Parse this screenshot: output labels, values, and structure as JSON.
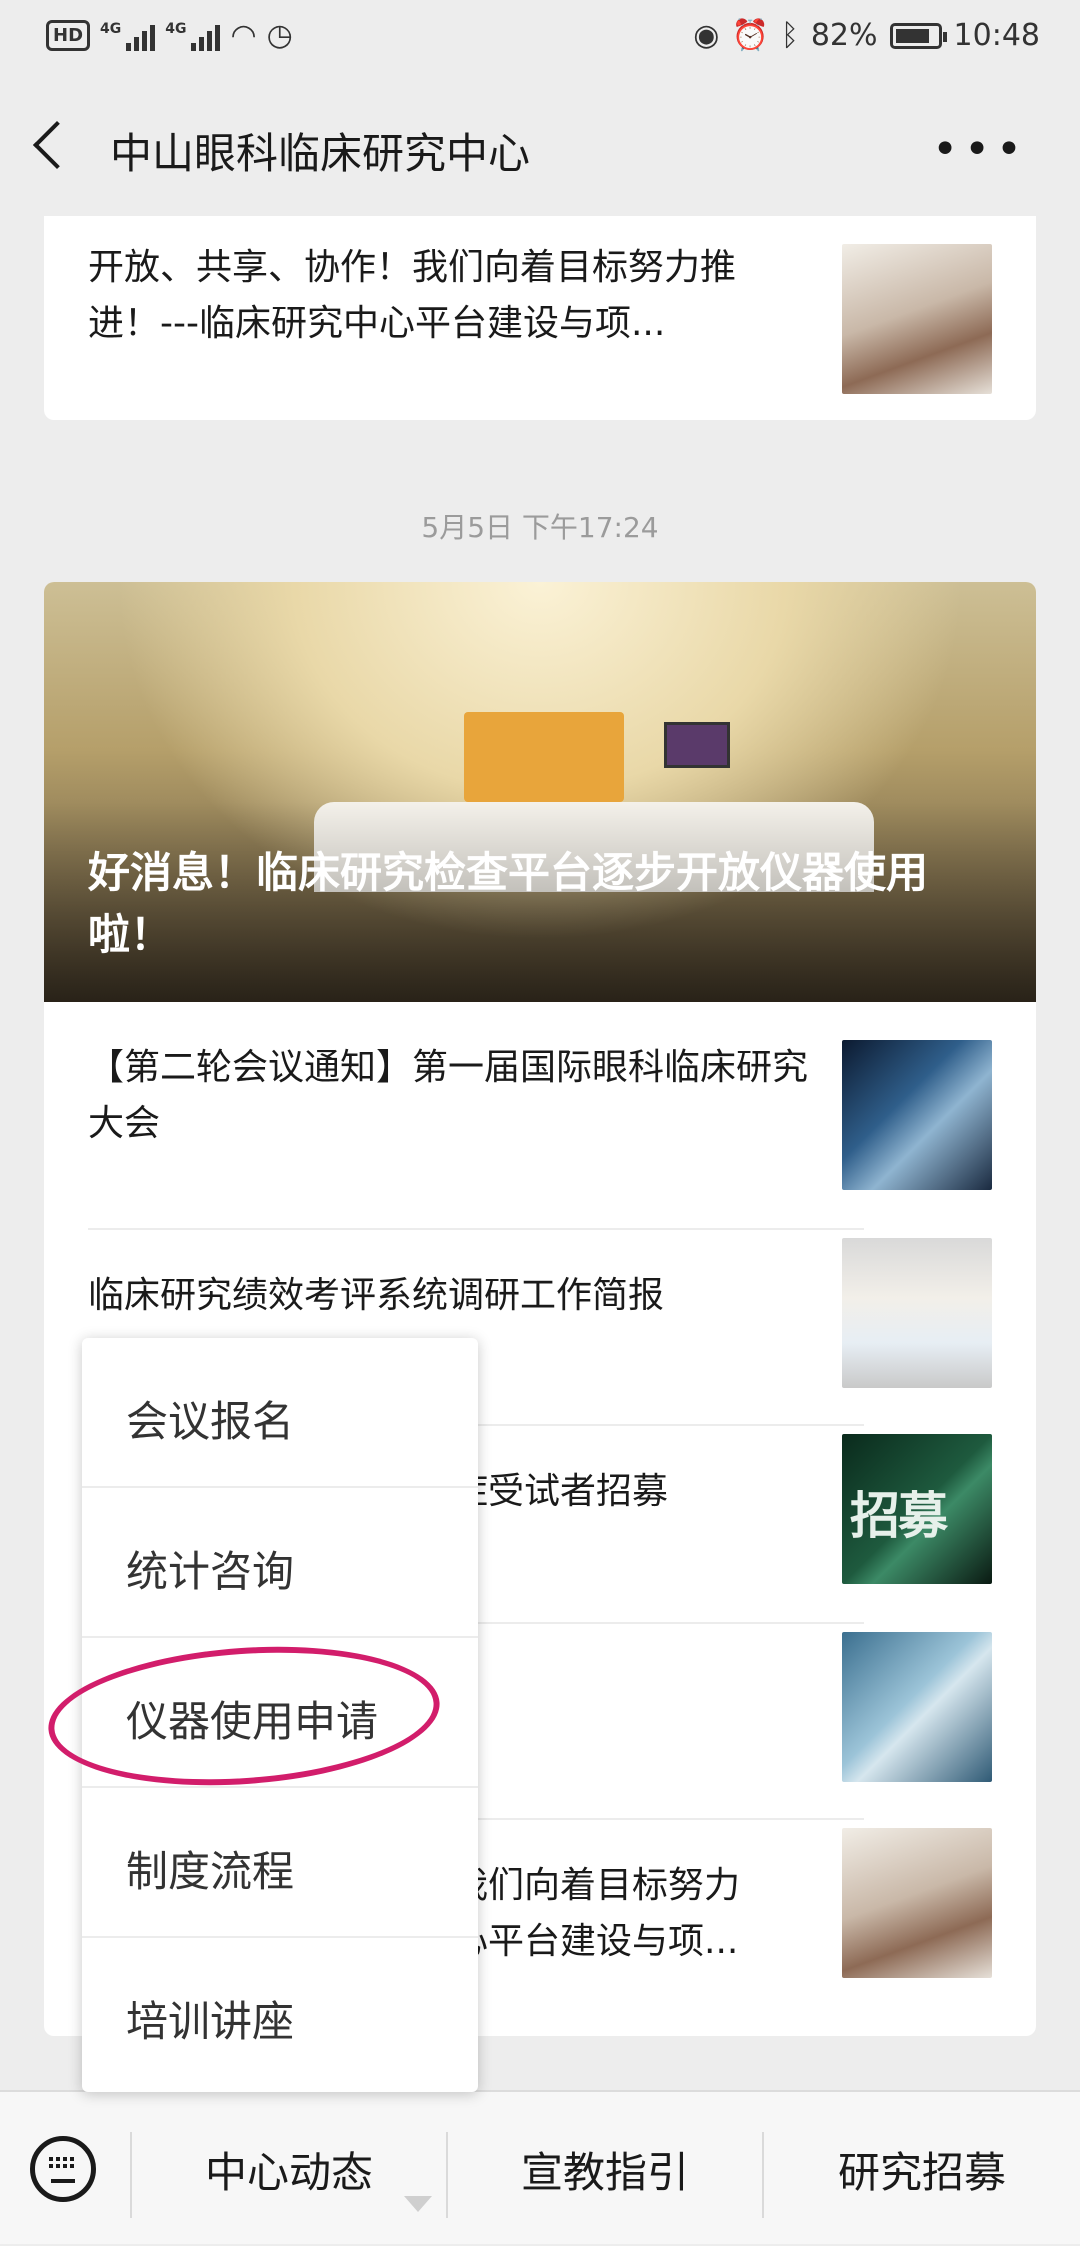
{
  "status_bar": {
    "hd": "HD",
    "net1": "4G",
    "net2": "4G",
    "battery_percent": "82%",
    "battery_level": 0.82,
    "time": "10:48"
  },
  "nav": {
    "title": "中山眼科临床研究中心"
  },
  "feed": {
    "top_card": {
      "title": "开放、共享、协作！我们向着目标努力推进！---临床研究中心平台建设与项..."
    },
    "timestamp": "5月5日 下午17:24",
    "hero": {
      "title": "好消息！临床研究检查平台逐步开放仪器使用啦！"
    },
    "articles": [
      {
        "title": "【第二轮会议通知】第一届国际眼科临床研究大会"
      },
      {
        "title": "临床研究绩效考评系统调研工作简报"
      },
      {
        "title": "症受试者招募"
      },
      {
        "title": ""
      },
      {
        "title": "我们向着目标努力\n心平台建设与项..."
      }
    ]
  },
  "popup_menu": {
    "items": [
      {
        "label": "会议报名"
      },
      {
        "label": "统计咨询"
      },
      {
        "label": "仪器使用申请",
        "highlighted": true
      },
      {
        "label": "制度流程"
      },
      {
        "label": "培训讲座"
      }
    ],
    "highlight_color": "#d21d6b"
  },
  "bottom_bar": {
    "tabs": [
      {
        "label": "中心动态"
      },
      {
        "label": "宣教指引"
      },
      {
        "label": "研究招募"
      }
    ]
  }
}
